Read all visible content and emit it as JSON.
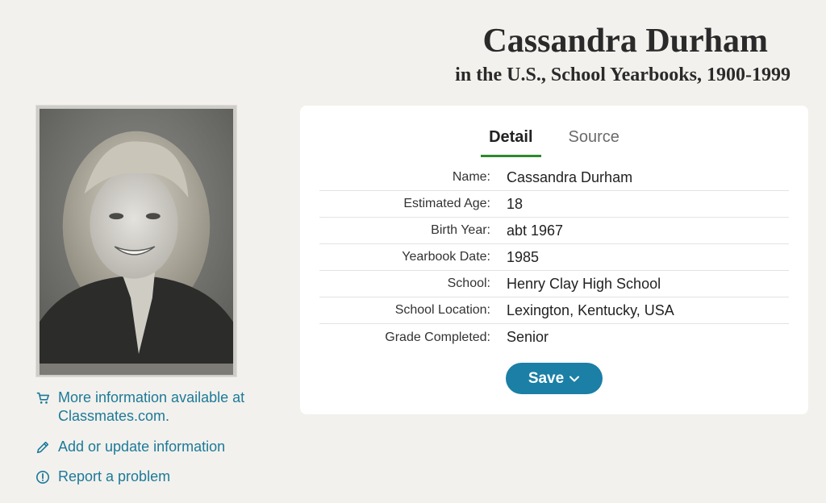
{
  "header": {
    "title": "Cassandra Durham",
    "subtitle": "in the U.S., School Yearbooks, 1900-1999"
  },
  "tabs": [
    {
      "label": "Detail",
      "active": true
    },
    {
      "label": "Source",
      "active": false
    }
  ],
  "details": [
    {
      "label": "Name:",
      "value": "Cassandra Durham"
    },
    {
      "label": "Estimated Age:",
      "value": "18"
    },
    {
      "label": "Birth Year:",
      "value": "abt 1967"
    },
    {
      "label": "Yearbook Date:",
      "value": "1985"
    },
    {
      "label": "School:",
      "value": "Henry Clay High School"
    },
    {
      "label": "School Location:",
      "value": "Lexington, Kentucky, USA"
    },
    {
      "label": "Grade Completed:",
      "value": "Senior"
    }
  ],
  "save_button": {
    "label": "Save",
    "icon": "chevron-down-icon"
  },
  "links": [
    {
      "icon": "cart-icon",
      "text": "More information available at Classmates.com."
    },
    {
      "icon": "pencil-icon",
      "text": "Add or update information"
    },
    {
      "icon": "alert-circle-icon",
      "text": "Report a problem"
    }
  ],
  "colors": {
    "background": "#f3f1ed",
    "link": "#1c7a99",
    "button": "#1b7fa6",
    "active_tab_underline": "#2c8a2c"
  }
}
